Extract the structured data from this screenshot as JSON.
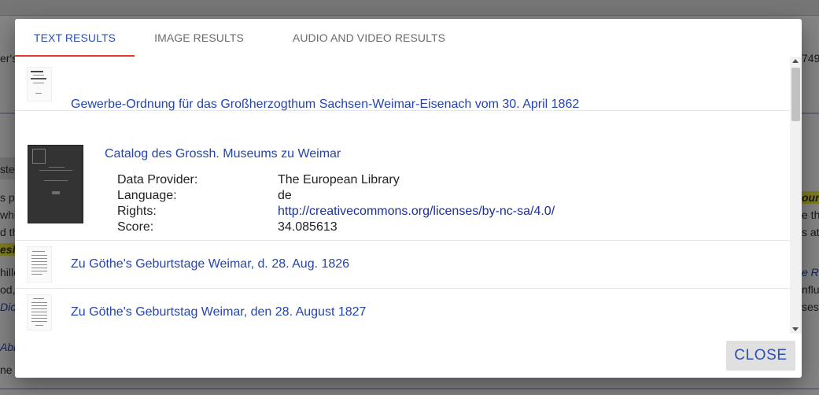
{
  "background_page": {
    "fragments": [
      "er's",
      "749",
      "ster",
      "s pr",
      "ounc",
      "whic",
      "e th",
      "d th",
      "s at",
      "esh",
      "hille",
      "e Ro",
      "od,",
      "nflue",
      "Dic",
      "ses",
      "Abl",
      "ne y"
    ]
  },
  "dialog": {
    "tabs": [
      {
        "label": "TEXT RESULTS",
        "active": true
      },
      {
        "label": "IMAGE RESULTS",
        "active": false
      },
      {
        "label": "AUDIO AND VIDEO RESULTS",
        "active": false
      }
    ],
    "results": [
      {
        "title": "Gewerbe-Ordnung für das Großherzogthum Sachsen-Weimar-Eisenach vom 30. April 1862"
      },
      {
        "title": "Catalog des Grossh. Museums zu Weimar",
        "meta": {
          "provider_label": "Data Provider:",
          "provider": "The European Library",
          "language_label": "Language:",
          "language": "de",
          "rights_label": "Rights:",
          "rights": "http://creativecommons.org/licenses/by-nc-sa/4.0/",
          "score_label": "Score:",
          "score": "34.085613"
        }
      },
      {
        "title": "Zu Göthe's Geburtstage Weimar, d. 28. Aug. 1826"
      },
      {
        "title": "Zu Göthe's Geburtstag Weimar, den 28. August 1827"
      }
    ],
    "close_label": "CLOSE"
  },
  "colors": {
    "accent": "#2e4fb3",
    "tab_indicator": "#e53935",
    "link": "#2545ad",
    "highlight": "#f5ef3b"
  }
}
